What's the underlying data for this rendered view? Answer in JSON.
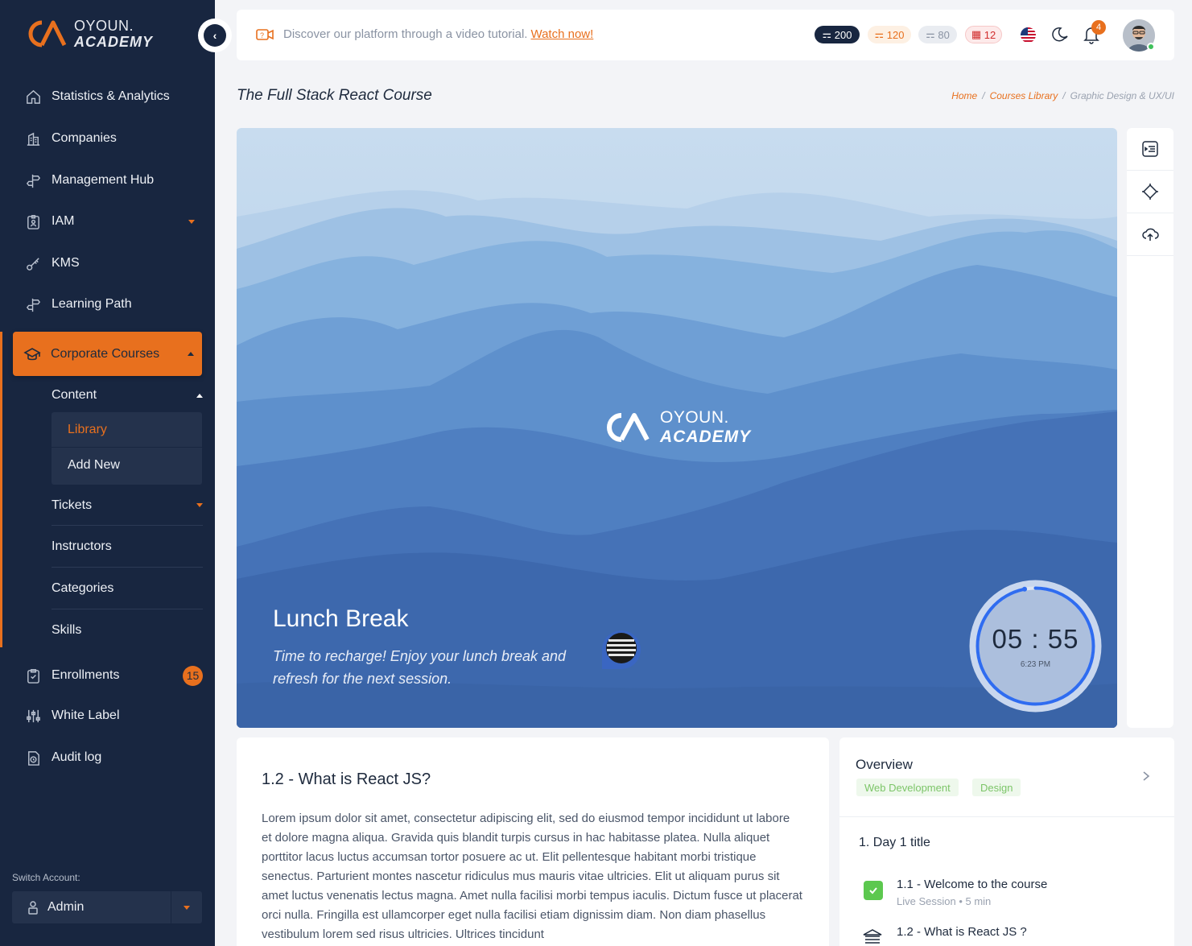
{
  "brand": {
    "line1": "OYOUN.",
    "line2": "ACADEMY"
  },
  "sidebar": {
    "items": [
      {
        "label": "Statistics & Analytics"
      },
      {
        "label": "Companies"
      },
      {
        "label": "Management Hub"
      },
      {
        "label": "IAM"
      },
      {
        "label": "KMS"
      },
      {
        "label": "Learning Path"
      }
    ],
    "active": {
      "label": "Corporate Courses"
    },
    "content_label": "Content",
    "content_children": [
      {
        "label": "Library"
      },
      {
        "label": "Add New"
      }
    ],
    "sub_items": [
      {
        "label": "Tickets"
      },
      {
        "label": "Instructors"
      },
      {
        "label": "Categories"
      },
      {
        "label": "Skills"
      }
    ],
    "bottom_items": [
      {
        "label": "Enrollments",
        "badge": "15"
      },
      {
        "label": "White Label"
      },
      {
        "label": "Audit log"
      }
    ],
    "switch_label": "Switch Account:",
    "account": "Admin"
  },
  "topbar": {
    "tutorial_text": "Discover our platform through a video tutorial.",
    "tutorial_link": "Watch now!",
    "stats": [
      {
        "value": "200",
        "color": "#182640"
      },
      {
        "value": "120",
        "color": "#e8701e"
      },
      {
        "value": "80",
        "color": "#8a93a3"
      },
      {
        "value": "12",
        "color": "#d12d2d"
      }
    ],
    "notifications": "4"
  },
  "page": {
    "title": "The Full Stack React Course",
    "breadcrumb": [
      "Home",
      "/",
      "Courses Library",
      "/",
      "Graphic Design & UX/UI"
    ]
  },
  "hero": {
    "heading": "Lunch Break",
    "subtitle": "Time to recharge! Enjoy your lunch break and refresh for the next session.",
    "timer": "05 : 55",
    "clock": "6:23 PM",
    "timer_progress": 0.97
  },
  "content": {
    "heading": "1.2 - What is React JS?",
    "body": "Lorem ipsum dolor sit amet, consectetur adipiscing elit, sed do eiusmod tempor incididunt ut labore et dolore magna aliqua. Gravida quis blandit turpis cursus in hac habitasse platea. Nulla aliquet porttitor lacus luctus accumsan tortor posuere ac ut. Elit pellentesque habitant morbi tristique senectus. Parturient montes nascetur ridiculus mus mauris vitae ultricies. Elit ut aliquam purus sit amet luctus venenatis lectus magna. Amet nulla facilisi morbi tempus iaculis. Dictum fusce ut placerat orci nulla. Fringilla est ullamcorper eget nulla facilisi etiam dignissim diam. Non diam phasellus vestibulum lorem sed risus ultricies. Ultrices tincidunt"
  },
  "overview": {
    "title": "Overview",
    "tags": [
      "Web Development",
      "Design"
    ],
    "day_title": "1.  Day 1 title",
    "lessons": [
      {
        "title": "1.1 - Welcome to the course",
        "meta": "Live Session • 5 min",
        "done": true
      },
      {
        "title": "1.2 - What is React JS ?",
        "meta": "",
        "done": false
      }
    ]
  }
}
